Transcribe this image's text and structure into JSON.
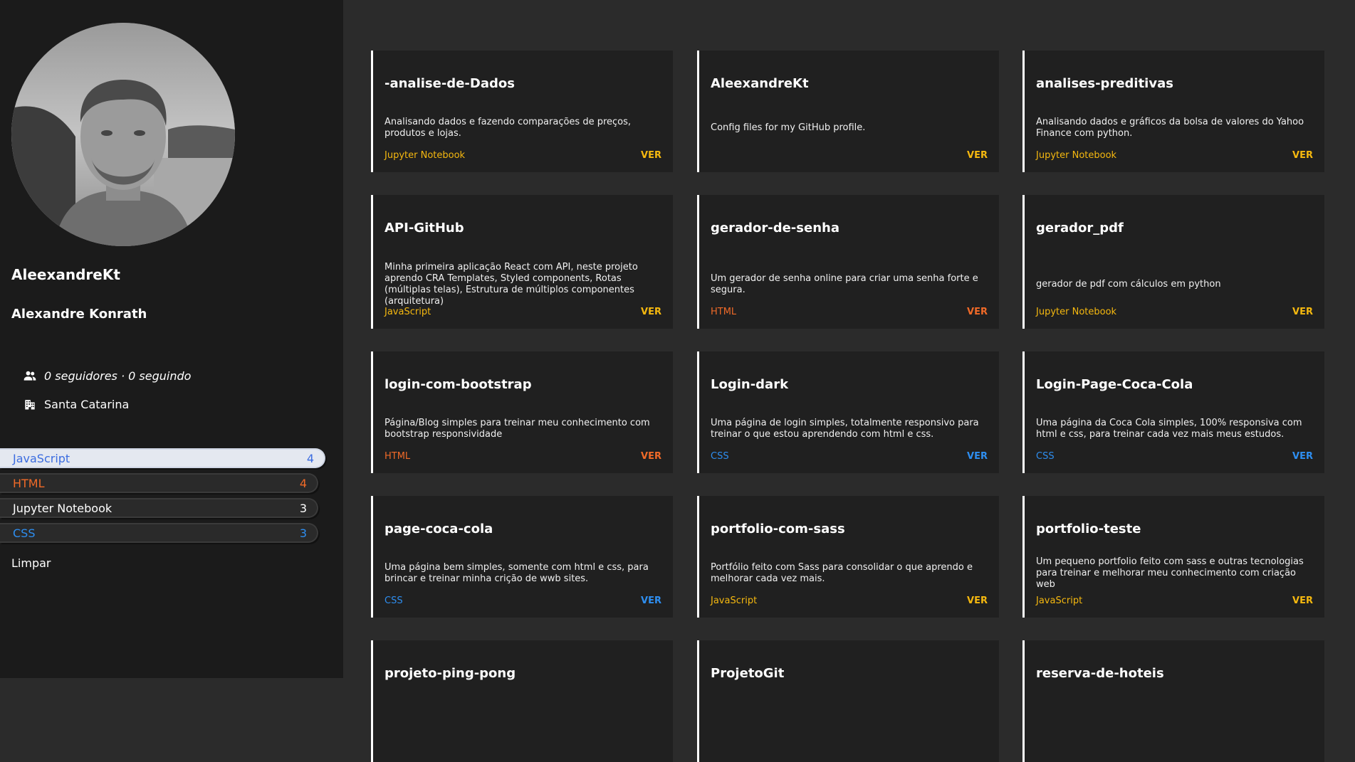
{
  "profile": {
    "login": "AleexandreKt",
    "name": "Alexandre Konrath",
    "followers_text": "0 seguidores · 0 seguindo",
    "location": "Santa Catarina"
  },
  "languages": [
    {
      "label": "JavaScript",
      "count": "4",
      "color": "#3b6ce0"
    },
    {
      "label": "HTML",
      "count": "4",
      "color": "#f06a28"
    },
    {
      "label": "Jupyter Notebook",
      "count": "3",
      "color": "#ffffff"
    },
    {
      "label": "CSS",
      "count": "3",
      "color": "#2e8ef0"
    }
  ],
  "clear_label": "Limpar",
  "colors": {
    "jupyter": "#f5b80f",
    "javascript": "#f5b80f",
    "html": "#f06a28",
    "css": "#2e8ef0",
    "none": "#f5b80f"
  },
  "repos": [
    {
      "name": "-analise-de-Dados",
      "description": "Analisando dados e fazendo comparações de preços, produtos e lojas.",
      "language": "Jupyter Notebook",
      "lang_key": "jupyter",
      "action": "VER"
    },
    {
      "name": "AleexandreKt",
      "description": "Config files for my GitHub profile.",
      "language": "",
      "lang_key": "none",
      "action": "VER"
    },
    {
      "name": "analises-preditivas",
      "description": "Analisando dados e gráficos da bolsa de valores do Yahoo Finance com python.",
      "language": "Jupyter Notebook",
      "lang_key": "jupyter",
      "action": "VER"
    },
    {
      "name": "API-GitHub",
      "description": "Minha primeira aplicação React com API, neste projeto aprendo CRA Templates, Styled components, Rotas (múltiplas telas), Estrutura de múltiplos componentes (arquitetura)",
      "language": "JavaScript",
      "lang_key": "javascript",
      "action": "VER"
    },
    {
      "name": "gerador-de-senha",
      "description": "Um gerador de senha online para criar uma senha forte e segura.",
      "language": "HTML",
      "lang_key": "html",
      "action": "VER"
    },
    {
      "name": "gerador_pdf",
      "description": "gerador de pdf com cálculos em python",
      "language": "Jupyter Notebook",
      "lang_key": "jupyter",
      "action": "VER"
    },
    {
      "name": "login-com-bootstrap",
      "description": "Página/Blog simples para treinar meu conhecimento com bootstrap responsividade",
      "language": "HTML",
      "lang_key": "html",
      "action": "VER"
    },
    {
      "name": "Login-dark",
      "description": "Uma página de login simples, totalmente responsivo para treinar o que estou aprendendo com html e css.",
      "language": "CSS",
      "lang_key": "css",
      "action": "VER"
    },
    {
      "name": "Login-Page-Coca-Cola",
      "description": "Uma página da Coca Cola simples, 100% responsiva com html e css, para treinar cada vez mais meus estudos.",
      "language": "CSS",
      "lang_key": "css",
      "action": "VER"
    },
    {
      "name": "page-coca-cola",
      "description": "Uma página bem simples, somente com html e css, para brincar e treinar minha crição de wwb sites.",
      "language": "CSS",
      "lang_key": "css",
      "action": "VER"
    },
    {
      "name": "portfolio-com-sass",
      "description": "Portfólio feito com Sass para consolidar o que aprendo e melhorar cada vez mais.",
      "language": "JavaScript",
      "lang_key": "javascript",
      "action": "VER"
    },
    {
      "name": "portfolio-teste",
      "description": "Um pequeno portfolio feito com sass e outras tecnologias para treinar e melhorar meu conhecimento com criação web",
      "language": "JavaScript",
      "lang_key": "javascript",
      "action": "VER"
    },
    {
      "name": "projeto-ping-pong",
      "description": "",
      "language": "",
      "lang_key": "none",
      "action": ""
    },
    {
      "name": "ProjetoGit",
      "description": "",
      "language": "",
      "lang_key": "none",
      "action": ""
    },
    {
      "name": "reserva-de-hoteis",
      "description": "",
      "language": "",
      "lang_key": "none",
      "action": ""
    }
  ]
}
